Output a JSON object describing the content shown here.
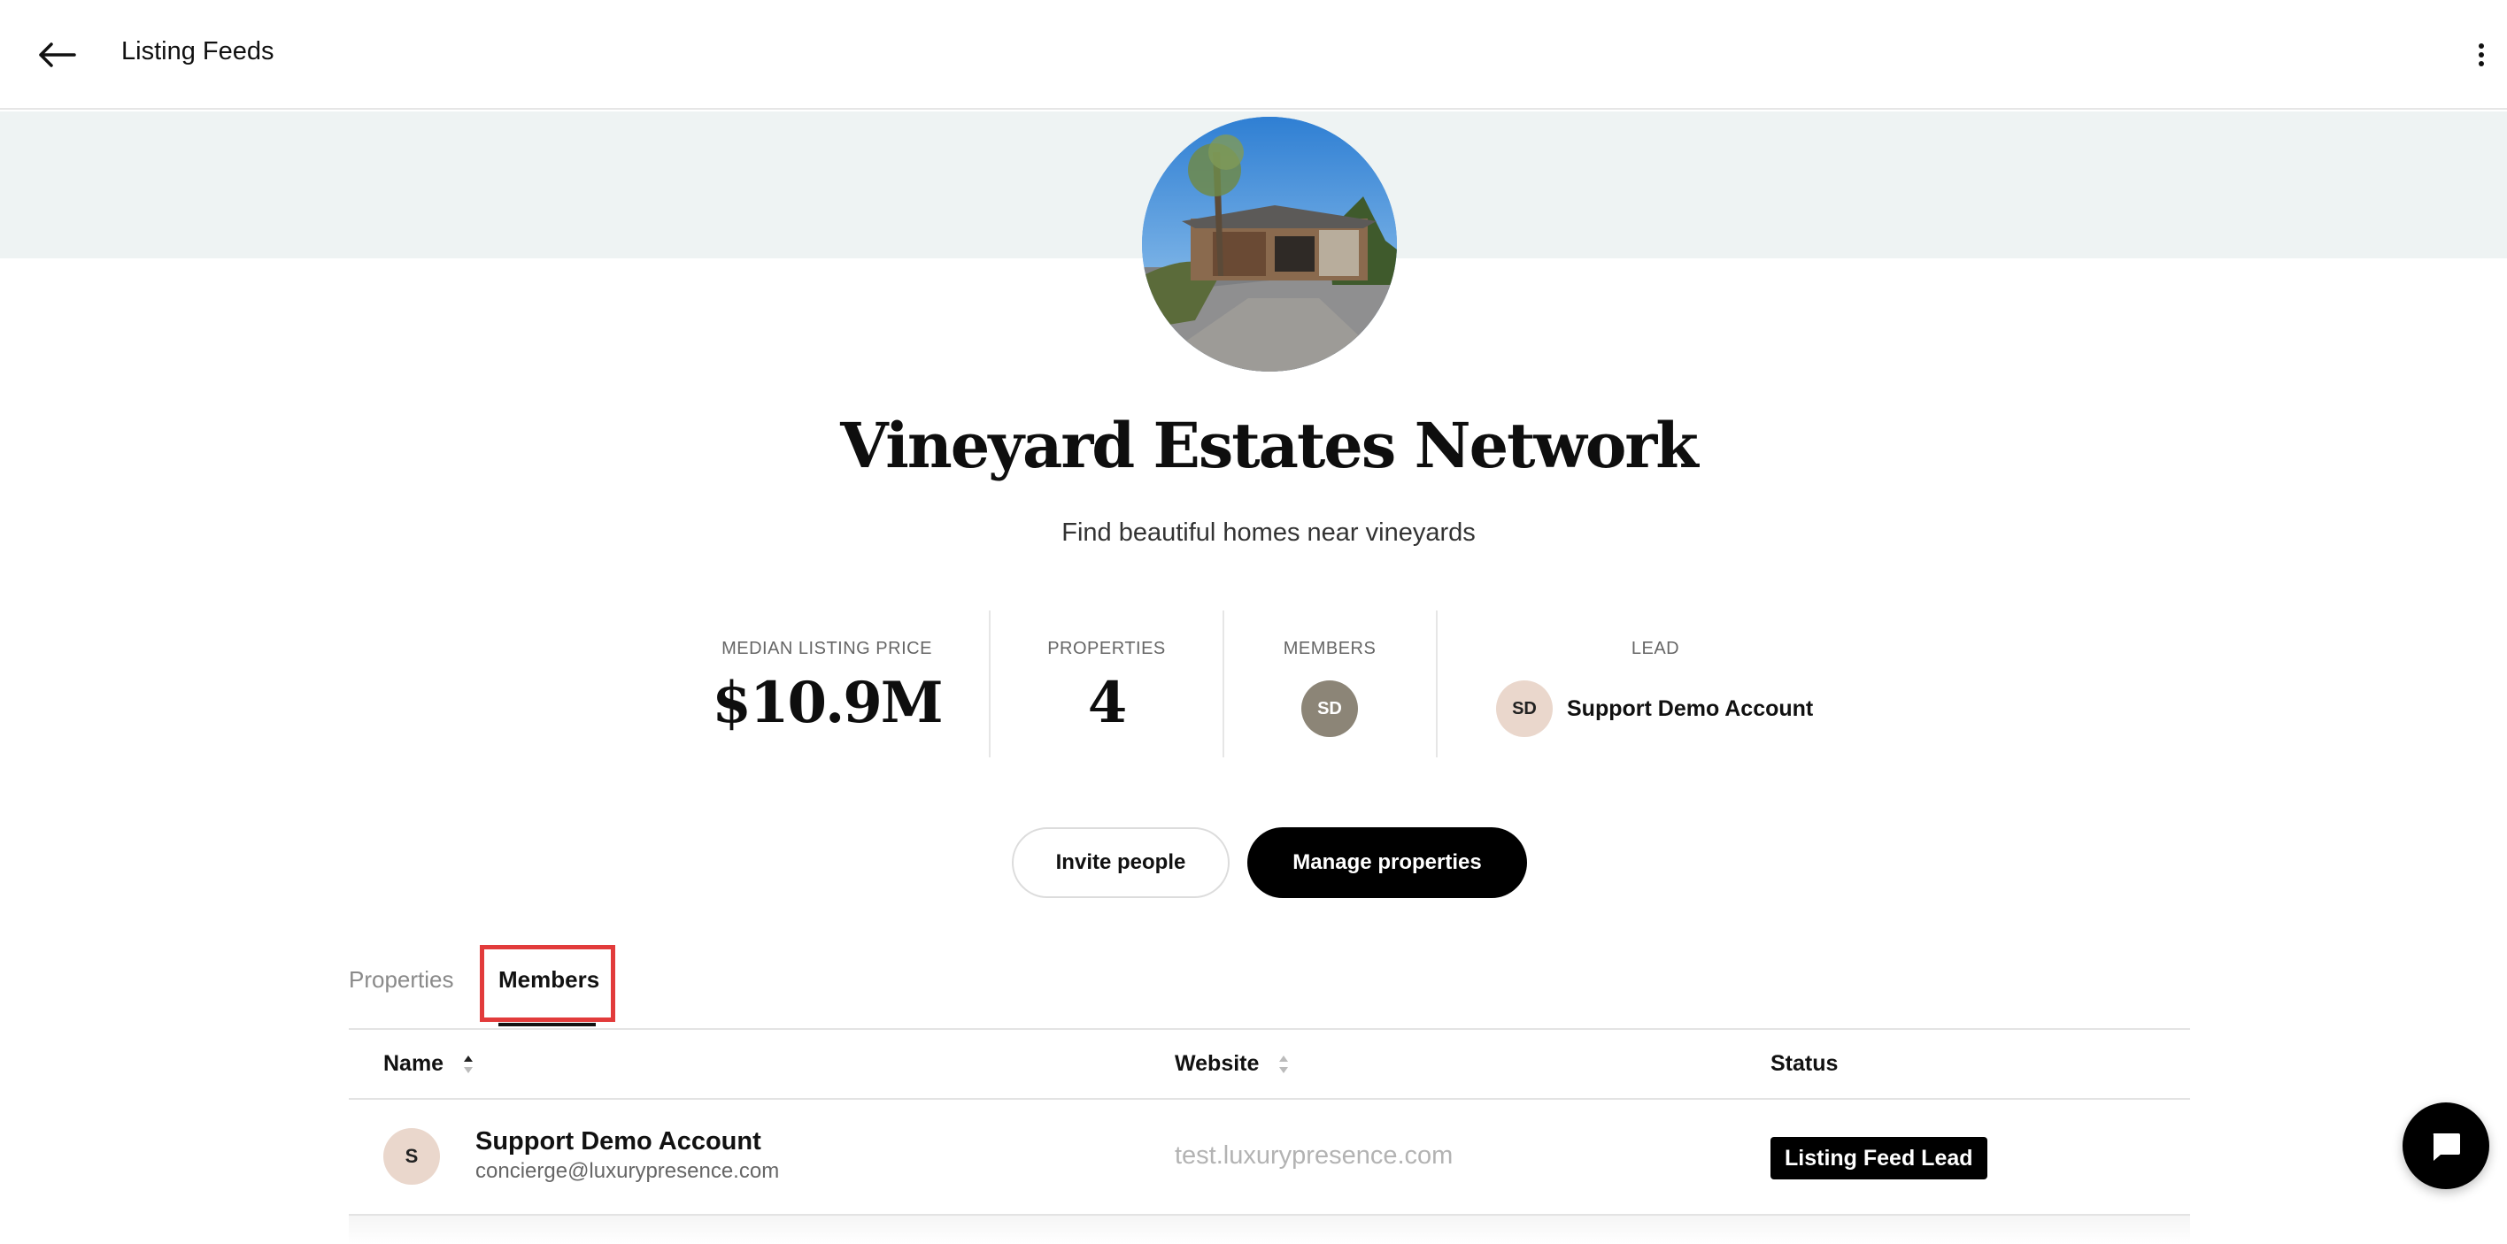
{
  "header": {
    "back_icon": "arrow-left-icon",
    "title": "Listing Feeds",
    "menu_icon": "kebab-menu-icon"
  },
  "feed": {
    "title": "Vineyard Estates Network",
    "subtitle": "Find beautiful homes near vineyards"
  },
  "stats": {
    "median_label": "MEDIAN LISTING PRICE",
    "median_value": "$10.9M",
    "properties_label": "PROPERTIES",
    "properties_value": "4",
    "members_label": "MEMBERS",
    "members_avatar": "SD",
    "lead_label": "LEAD",
    "lead_avatar": "SD",
    "lead_name": "Support Demo Account"
  },
  "actions": {
    "invite": "Invite people",
    "manage": "Manage properties"
  },
  "tabs": [
    {
      "label": "Properties",
      "active": false
    },
    {
      "label": "Members",
      "active": true
    }
  ],
  "table": {
    "columns": {
      "name": "Name",
      "website": "Website",
      "status": "Status"
    },
    "rows": [
      {
        "avatar": "S",
        "name": "Support Demo Account",
        "email": "concierge@luxurypresence.com",
        "website": "test.luxurypresence.com",
        "status": "Listing Feed Lead"
      }
    ]
  },
  "chat": {
    "icon": "chat-bubble-icon"
  },
  "colors": {
    "banner": "#eef3f3",
    "highlight": "#e23b3b",
    "members_avatar_bg": "#8c8577",
    "lead_avatar_bg": "#ead7cc"
  }
}
